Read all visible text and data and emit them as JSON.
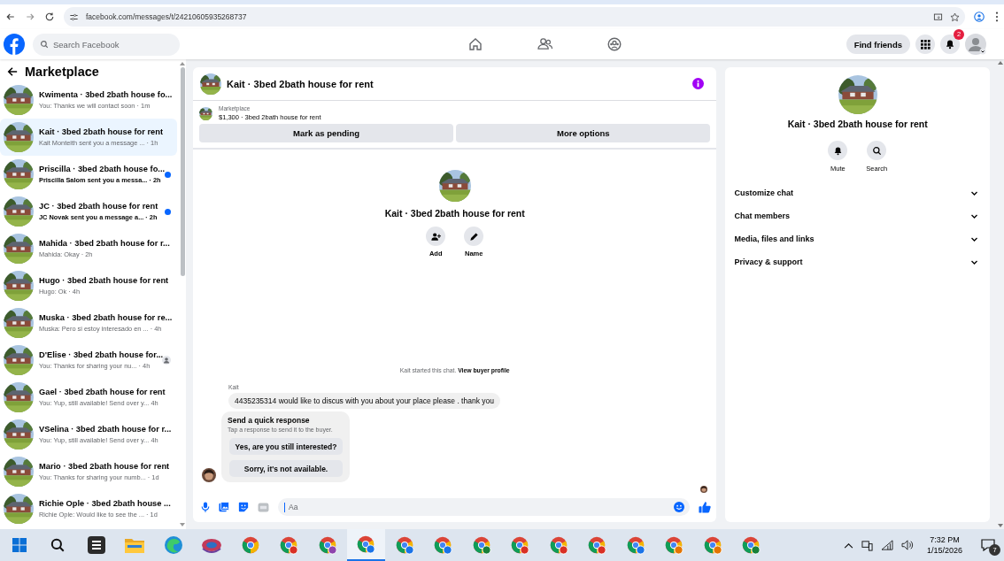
{
  "browser": {
    "url": "facebook.com/messages/t/24210605935268737"
  },
  "topnav": {
    "search_placeholder": "Search Facebook",
    "find_friends": "Find friends",
    "notification_count": "2"
  },
  "sidebar": {
    "title": "Marketplace",
    "conversations": [
      {
        "title": "Kwimenta · 3bed 2bath house fo...",
        "snippet": "You: Thanks we will contact soon · 1m",
        "selected": false,
        "unread": false,
        "seen": false
      },
      {
        "title": "Kait · 3bed 2bath house for rent",
        "snippet": "Kait Monteith sent you a message ... · 1h",
        "selected": true,
        "unread": false,
        "seen": false
      },
      {
        "title": "Priscilla · 3bed 2bath house fo...",
        "snippet": "Priscilla Salom sent you a messa... · 2h",
        "selected": false,
        "unread": true,
        "seen": false
      },
      {
        "title": "JC · 3bed 2bath house for rent",
        "snippet": "JC Novak sent you a message a... · 2h",
        "selected": false,
        "unread": true,
        "seen": false
      },
      {
        "title": "Mahida · 3bed 2bath house for r...",
        "snippet": "Mahida: Okay · 2h",
        "selected": false,
        "unread": false,
        "seen": false
      },
      {
        "title": "Hugo · 3bed 2bath house for rent",
        "snippet": "Hugo: Ok · 4h",
        "selected": false,
        "unread": false,
        "seen": false
      },
      {
        "title": "Muska · 3bed 2bath house for re...",
        "snippet": "Muska: Pero si estoy interesado en ... · 4h",
        "selected": false,
        "unread": false,
        "seen": false
      },
      {
        "title": "D'Elise · 3bed 2bath house for...",
        "snippet": "You: Thanks for sharing your nu... · 4h",
        "selected": false,
        "unread": false,
        "seen": true
      },
      {
        "title": "Gael · 3bed 2bath house for rent",
        "snippet": "You: Yup, still available! Send over y... 4h",
        "selected": false,
        "unread": false,
        "seen": false
      },
      {
        "title": "VSelina · 3bed 2bath house for r...",
        "snippet": "You: Yup, still available! Send over y... 4h",
        "selected": false,
        "unread": false,
        "seen": false
      },
      {
        "title": "Mario · 3bed 2bath house for rent",
        "snippet": "You: Thanks for sharing your numb... · 1d",
        "selected": false,
        "unread": false,
        "seen": false
      },
      {
        "title": "Richie Ople · 3bed 2bath house ...",
        "snippet": "Richie Ople: Would like to see the ... · 1d",
        "selected": false,
        "unread": false,
        "seen": false
      }
    ]
  },
  "chat": {
    "title": "Kait · 3bed 2bath house for rent",
    "listing": {
      "label": "Marketplace",
      "summary": "$1,300 · 3bed 2bath house for rent"
    },
    "actions": [
      "Mark as pending",
      "More options"
    ],
    "profile": {
      "name": "Kait · 3bed 2bath house for rent",
      "actions": [
        "Add",
        "Name"
      ]
    },
    "notice": {
      "text": "Kait started this chat.",
      "link": "View buyer profile"
    },
    "message": {
      "sender": "Kait",
      "text": "4435235314 would like to discus with you about your place please . thank you"
    },
    "quick_response": {
      "title": "Send a quick response",
      "hint": "Tap a response to send it to the buyer.",
      "options": [
        "Yes, are you still interested?",
        "Sorry, it's not available."
      ]
    },
    "composer": {
      "placeholder": "Aa"
    }
  },
  "details": {
    "name": "Kait · 3bed 2bath house for rent",
    "actions": [
      "Mute",
      "Search"
    ],
    "sections": [
      {
        "label": "Customize chat",
        "expanded": false
      },
      {
        "label": "Chat members",
        "expanded": false
      },
      {
        "label": "Media, files and links",
        "expanded": false
      },
      {
        "label": "Privacy & support",
        "expanded": false
      }
    ]
  },
  "taskbar": {
    "time": "7:32 PM",
    "date": "1/15/2026",
    "notification_count": "7",
    "apps": [
      {
        "kind": "search",
        "selected": false
      },
      {
        "kind": "tasks",
        "selected": false
      },
      {
        "kind": "explorer",
        "selected": false
      },
      {
        "kind": "edge",
        "selected": false
      },
      {
        "kind": "app",
        "selected": false
      },
      {
        "kind": "browser",
        "selected": false
      },
      {
        "kind": "browser",
        "selected": false,
        "color": "#d93025"
      },
      {
        "kind": "browser",
        "selected": false,
        "color": "#8e44ad"
      },
      {
        "kind": "browser",
        "selected": true,
        "color": "#1a73e8"
      },
      {
        "kind": "browser",
        "selected": false,
        "color": "#1a73e8"
      },
      {
        "kind": "browser",
        "selected": false,
        "color": "#1a73e8"
      },
      {
        "kind": "browser",
        "selected": false,
        "color": "#188038"
      },
      {
        "kind": "browser",
        "selected": false,
        "color": "#d93025"
      },
      {
        "kind": "browser",
        "selected": false,
        "color": "#d93025"
      },
      {
        "kind": "browser",
        "selected": false,
        "color": "#d93025"
      },
      {
        "kind": "browser",
        "selected": false,
        "color": "#1a73e8"
      },
      {
        "kind": "browser",
        "selected": false,
        "color": "#e37400"
      },
      {
        "kind": "browser",
        "selected": false,
        "color": "#e37400"
      },
      {
        "kind": "browser",
        "selected": false,
        "color": "#188038"
      }
    ]
  }
}
